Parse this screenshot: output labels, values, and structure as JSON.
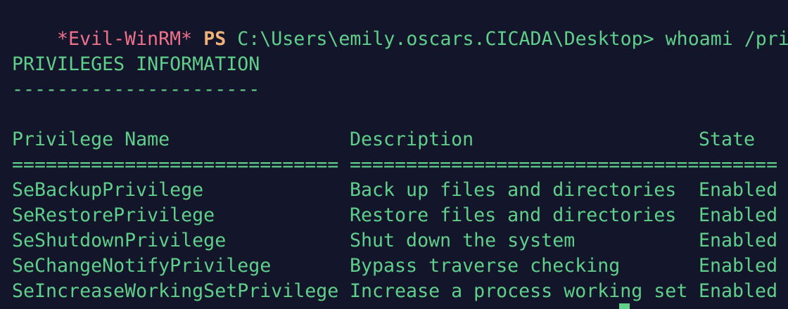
{
  "prompt": {
    "shell": "*Evil-WinRM*",
    "ps": "PS",
    "path": "C:\\Users\\emily.oscars.CICADA\\Desktop>",
    "command": "whoami /priv"
  },
  "section": {
    "title": "PRIVILEGES INFORMATION",
    "underline": "----------------------"
  },
  "table": {
    "headers": [
      "Privilege Name",
      "Description",
      "State"
    ],
    "separators": [
      "=============================",
      "===============================",
      "======="
    ],
    "rows": [
      [
        "SeBackupPrivilege",
        "Back up files and directories",
        "Enabled"
      ],
      [
        "SeRestorePrivilege",
        "Restore files and directories",
        "Enabled"
      ],
      [
        "SeShutdownPrivilege",
        "Shut down the system",
        "Enabled"
      ],
      [
        "SeChangeNotifyPrivilege",
        "Bypass traverse checking",
        "Enabled"
      ],
      [
        "SeIncreaseWorkingSetPrivilege",
        "Increase a process working set",
        "Enabled"
      ]
    ]
  },
  "colors": {
    "background": "#13162a",
    "text": "#5fcf8a",
    "prompt_shell": "#f0708a",
    "prompt_ps": "#f1b27a"
  }
}
